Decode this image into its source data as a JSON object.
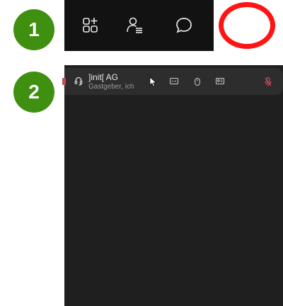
{
  "steps": {
    "step1": "1",
    "step2": "2"
  },
  "toolbar": {
    "icons": [
      "apps-add-icon",
      "people-list-icon",
      "chat-icon"
    ],
    "highlighted": "chat-icon",
    "highlight_color": "#ff1414"
  },
  "participant": {
    "name": "]init[ AG",
    "role": "Gastgeber, ich",
    "icons": [
      "headset-icon",
      "cursor-icon",
      "cc-icon",
      "mouse-icon",
      "id-card-icon",
      "mic-off-icon"
    ],
    "mic_status_color": "#e0505a"
  },
  "colors": {
    "badge": "#3f8f10",
    "toolbar_bg": "#121212",
    "panel_bg": "#1f1f1f",
    "row_bg": "#2d2d2d"
  }
}
